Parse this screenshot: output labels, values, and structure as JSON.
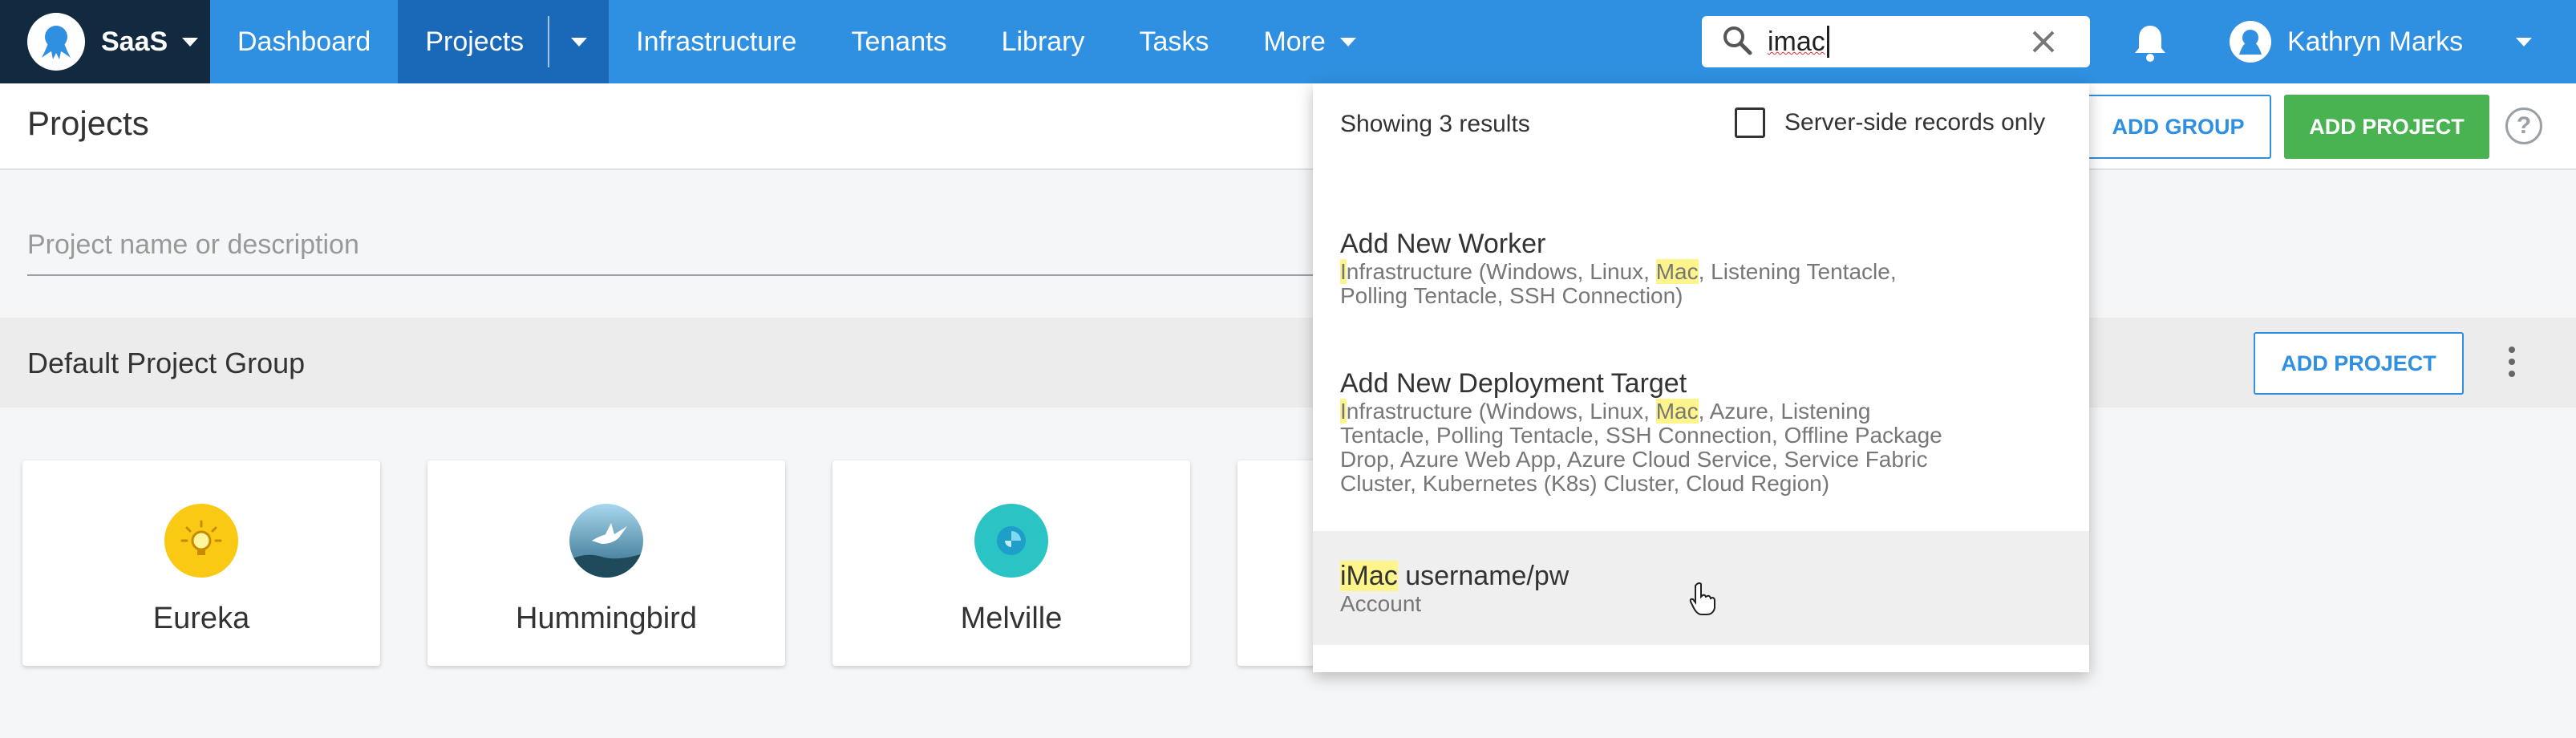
{
  "nav": {
    "brand": "SaaS",
    "items": [
      "Dashboard",
      "Projects",
      "Infrastructure",
      "Tenants",
      "Library",
      "Tasks",
      "More"
    ],
    "search_value": "imac",
    "user_name": "Kathryn Marks"
  },
  "page": {
    "title": "Projects",
    "add_group": "ADD GROUP",
    "add_project": "ADD PROJECT",
    "help": "?",
    "filter_placeholder": "Project name or description"
  },
  "group": {
    "title": "Default Project Group",
    "add_project": "ADD PROJECT"
  },
  "projects": [
    "Eureka",
    "Hummingbird",
    "Melville"
  ],
  "search_results": {
    "count_text": "Showing 3 results",
    "server_side_label": "Server-side records only",
    "server_side_checked": false,
    "results": [
      {
        "title": "Add New Worker",
        "sub_parts": [
          "",
          "I",
          "nfrastructure (Windows, Linux, ",
          "Mac",
          ", Listening Tentacle,",
          "Polling Tentacle, SSH Connection)"
        ]
      },
      {
        "title": "Add New Deployment Target",
        "sub_parts": [
          "",
          "I",
          "nfrastructure (Windows, Linux, ",
          "Mac",
          ", Azure, Listening",
          "Tentacle, Polling Tentacle, SSH Connection, Offline Package",
          "Drop, Azure Web App, Azure Cloud Service, Service Fabric",
          "Cluster, Kubernetes (K8s) Cluster, Cloud Region)"
        ]
      },
      {
        "title_highlight": "iMac",
        "title_rest": " username/pw",
        "sub": "Account"
      }
    ]
  },
  "colors": {
    "nav_bg": "#2f8fe0",
    "nav_active": "#1a69b8",
    "brand_bg": "#122a40",
    "accent_green": "#48b350",
    "highlight": "#fdf58b"
  }
}
